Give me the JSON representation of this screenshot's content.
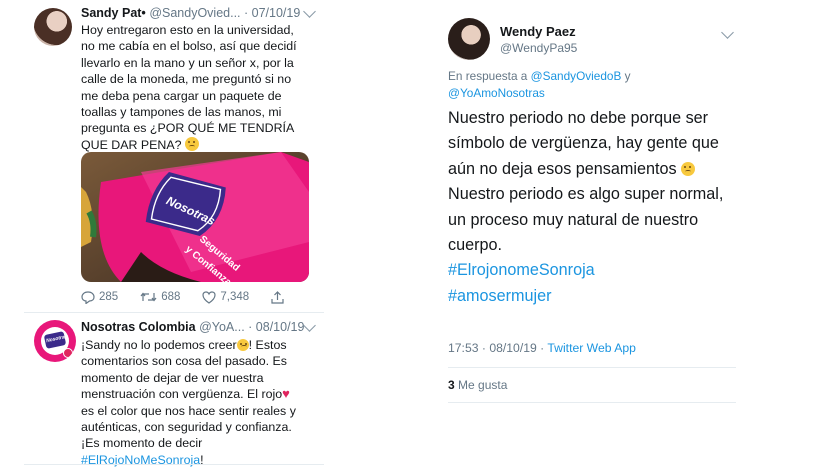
{
  "left_thread": {
    "tweet1": {
      "name": "Sandy Pat•",
      "handle": "@SandyOvied...",
      "date": "· 07/10/19",
      "text": "Hoy entregaron esto en la universidad,\nno me cabía en el bolso, así que decidí\nllevarlo en la mano y un señor x, por la\ncalle de la moneda, me preguntó si no\nme deba pena cargar un paquete de\ntoallas y tampones de las manos, mi\npregunta es ¿POR QUÉ ME TENDRÍA\nQUE DAR PENA?",
      "media_label": "Nosotras",
      "media_slogan": "Seguridad\ny Confianza",
      "replies": "285",
      "retweets": "688",
      "likes": "7,348"
    },
    "tweet2": {
      "name": "Nosotras Colombia",
      "handle": "@YoA...",
      "date": "· 08/10/19",
      "text_a": "¡Sandy no lo podemos creer",
      "text_b": "! Estos\ncomentarios son cosa del pasado. Es\nmomento de dejar de ver nuestra\nmenstruación con vergüenza. El rojo",
      "text_c": "\nes el color que nos hace sentir reales y\nauténticas, con seguridad y confianza.\n¡Es momento de decir\n",
      "hashtag": "#ElRojoNoMeSonroja",
      "text_end": "!",
      "avatar_label": "Nosotras"
    }
  },
  "right_tweet": {
    "name": "Wendy Paez",
    "handle": "@WendyPa95",
    "reply_prefix": "En respuesta a ",
    "reply_user1": "@SandyOviedoB",
    "reply_and": " y",
    "reply_user2": "@YoAmoNosotras",
    "text_1": "Nuestro periodo no debe porque ser\nsímbolo de vergüenza, hay gente que\naún no deja esos pensamientos ",
    "text_2": "\nNuestro periodo es algo super normal,\nun proceso muy natural de nuestro\ncuerpo.",
    "hashtag1": "#ElrojonomeSonroja",
    "hashtag2": "#amosermujer",
    "timestamp": "17:53 · 08/10/19",
    "source": "Twitter Web App",
    "likes_count": "3",
    "likes_label": " Me gusta"
  },
  "colors": {
    "link": "#1b95e0",
    "muted": "#657786",
    "pink": "#e8177a",
    "purple": "#3b2a8a"
  }
}
